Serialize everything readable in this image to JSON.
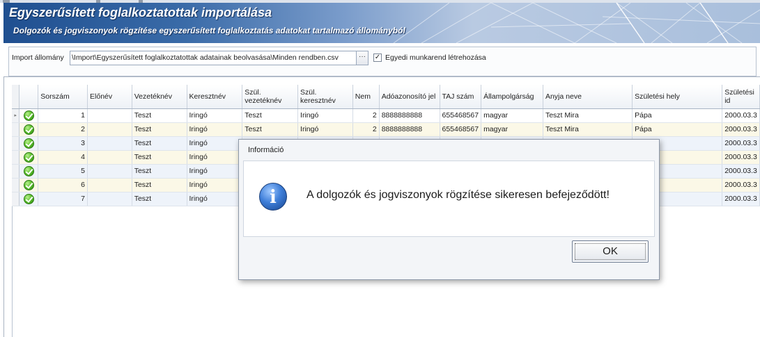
{
  "header": {
    "title": "Egyszerűsített foglalkoztatottak importálása",
    "subtitle": "Dolgozók és jogviszonyok rögzítése egyszerűsített foglalkoztatás adatokat tartalmazó állományból"
  },
  "import": {
    "label": "Import állomány",
    "value": "\\Import\\Egyszerűsített foglalkoztatottak adatainak beolvasása\\Minden rendben.csv",
    "browse_label": "···",
    "checkbox_label": "Egyedi munkarend létrehozása",
    "checkbox_checked": true,
    "checkbox_mark": "✓"
  },
  "grid": {
    "columns": [
      "Sorszám",
      "Előnév",
      "Vezetéknév",
      "Keresztnév",
      "Szül. vezetéknév",
      "Szül. keresztnév",
      "Nem",
      "Adóazonosító jel",
      "TAJ szám",
      "Állampolgárság",
      "Anyja neve",
      "Születési hely",
      "Születési id"
    ],
    "current_row_marker": "▸",
    "rows": [
      {
        "status": "ok",
        "sorszam": "1",
        "elonev": "",
        "vezeteknev": "Teszt",
        "keresztnev": "Iringó",
        "szul_vezeteknev": "Teszt",
        "szul_keresztnev": "Iringó",
        "nem": "2",
        "adoazonosito": "8888888888",
        "taj": "655468567",
        "allampolgarsag": "magyar",
        "anyja_neve": "Teszt Mira",
        "szuletesi_hely": "Pápa",
        "szuletesi_ido": "2000.03.3"
      },
      {
        "status": "ok",
        "sorszam": "2",
        "elonev": "",
        "vezeteknev": "Teszt",
        "keresztnev": "Iringó",
        "szul_vezeteknev": "Teszt",
        "szul_keresztnev": "Iringó",
        "nem": "2",
        "adoazonosito": "8888888888",
        "taj": "655468567",
        "allampolgarsag": "magyar",
        "anyja_neve": "Teszt Mira",
        "szuletesi_hely": "Pápa",
        "szuletesi_ido": "2000.03.3"
      },
      {
        "status": "ok",
        "sorszam": "3",
        "elonev": "",
        "vezeteknev": "Teszt",
        "keresztnev": "Iringó",
        "szuletesi_ido": "2000.03.3"
      },
      {
        "status": "ok",
        "sorszam": "4",
        "elonev": "",
        "vezeteknev": "Teszt",
        "keresztnev": "Iringó",
        "szuletesi_ido": "2000.03.3"
      },
      {
        "status": "ok",
        "sorszam": "5",
        "elonev": "",
        "vezeteknev": "Teszt",
        "keresztnev": "Iringó",
        "szuletesi_ido": "2000.03.3"
      },
      {
        "status": "ok",
        "sorszam": "6",
        "elonev": "",
        "vezeteknev": "Teszt",
        "keresztnev": "Iringó",
        "szuletesi_ido": "2000.03.3"
      },
      {
        "status": "ok",
        "sorszam": "7",
        "elonev": "",
        "vezeteknev": "Teszt",
        "keresztnev": "Iringó",
        "szuletesi_ido": "2000.03.3"
      }
    ]
  },
  "dialog": {
    "title": "Információ",
    "message": "A dolgozók és jogviszonyok rögzítése sikeresen befejeződött!",
    "icon": "info-icon",
    "icon_glyph": "i",
    "ok_label": "OK"
  },
  "colors": {
    "header_dark": "#1f4f90",
    "row_alt_yellow": "#fbf8e7",
    "row_alt_blue": "#eef3fa",
    "status_ok": "#5ec12e"
  }
}
